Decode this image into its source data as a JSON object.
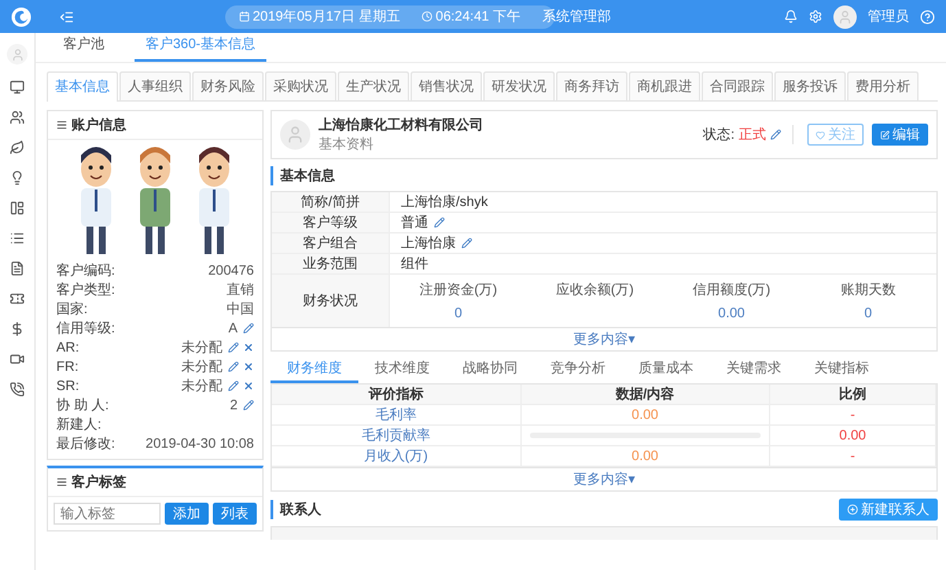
{
  "topbar": {
    "date": "2019年05月17日 星期五",
    "time": "06:24:41 下午",
    "department": "系统管理部",
    "user": "管理员"
  },
  "breadcrumbs": [
    {
      "label": "客户池",
      "selected": false
    },
    {
      "label": "客户360-基本信息",
      "selected": true
    }
  ],
  "tabs": [
    {
      "label": "基本信息",
      "selected": true
    },
    {
      "label": "人事组织",
      "selected": false
    },
    {
      "label": "财务风险",
      "selected": false
    },
    {
      "label": "采购状况",
      "selected": false
    },
    {
      "label": "生产状况",
      "selected": false
    },
    {
      "label": "销售状况",
      "selected": false
    },
    {
      "label": "研发状况",
      "selected": false
    },
    {
      "label": "商务拜访",
      "selected": false
    },
    {
      "label": "商机跟进",
      "selected": false
    },
    {
      "label": "合同跟踪",
      "selected": false
    },
    {
      "label": "服务投诉",
      "selected": false
    },
    {
      "label": "费用分析",
      "selected": false
    }
  ],
  "account_panel": {
    "title": "账户信息",
    "fields": [
      {
        "label": "客户编码:",
        "value": "200476",
        "editable": false,
        "removable": false
      },
      {
        "label": "客户类型:",
        "value": "直销",
        "editable": false,
        "removable": false
      },
      {
        "label": "国家:",
        "value": "中国",
        "editable": false,
        "removable": false
      },
      {
        "label": "信用等级:",
        "value": "A",
        "editable": true,
        "removable": false
      },
      {
        "label": "AR:",
        "value": "未分配",
        "editable": true,
        "removable": true
      },
      {
        "label": "FR:",
        "value": "未分配",
        "editable": true,
        "removable": true
      },
      {
        "label": "SR:",
        "value": "未分配",
        "editable": true,
        "removable": true
      },
      {
        "label": "协 助 人:",
        "value": "2",
        "editable": true,
        "removable": false
      },
      {
        "label": "新建人:",
        "editable": false,
        "removable": false
      },
      {
        "label": "最后修改:",
        "value": "2019-04-30 10:08",
        "editable": false,
        "removable": false
      }
    ]
  },
  "tag_panel": {
    "title": "客户标签",
    "placeholder": "输入标签",
    "buttons": [
      "添加",
      "列表"
    ]
  },
  "company": {
    "name": "上海怡康化工材料有限公司",
    "subtitle": "基本资料",
    "status_label": "状态:",
    "status": "正式",
    "buttons": [
      {
        "label": "关注",
        "kind": "outline"
      },
      {
        "label": "编辑",
        "kind": "primary"
      }
    ]
  },
  "basic_info": {
    "title": "基本信息",
    "rows": [
      {
        "label": "简称/简拼",
        "value": "上海怡康/shyk",
        "editable": false
      },
      {
        "label": "客户等级",
        "value": "普通",
        "editable": true
      },
      {
        "label": "客户组合",
        "value": "上海怡康",
        "editable": true
      },
      {
        "label": "业务范围",
        "value": "组件",
        "editable": false
      }
    ],
    "finance": {
      "label": "财务状况",
      "columns": [
        {
          "label": "注册资金(万)",
          "value": "0"
        },
        {
          "label": "应收余额(万)"
        },
        {
          "label": "信用额度(万)",
          "value": "0.00"
        },
        {
          "label": "账期天数",
          "value": "0"
        }
      ]
    },
    "more": "更多内容▾"
  },
  "sub_tabs": [
    {
      "label": "财务维度",
      "selected": true
    },
    {
      "label": "技术维度",
      "selected": false
    },
    {
      "label": "战略协同",
      "selected": false
    },
    {
      "label": "竞争分析",
      "selected": false
    },
    {
      "label": "质量成本",
      "selected": false
    },
    {
      "label": "关键需求",
      "selected": false
    },
    {
      "label": "关键指标",
      "selected": false
    }
  ],
  "metrics_table": {
    "columns": [
      "评价指标",
      "数据/内容",
      "比例"
    ],
    "rows": [
      {
        "name": "毛利率",
        "kind": "text",
        "value": "0.00",
        "ratio": "-"
      },
      {
        "name": "毛利贡献率",
        "kind": "bar",
        "level": 0,
        "ratio": "0.00"
      },
      {
        "name": "月收入(万)",
        "kind": "text",
        "value": "0.00",
        "ratio": "-"
      }
    ],
    "more": "更多内容▾"
  },
  "contacts": {
    "title": "联系人",
    "button": "新建联系人"
  }
}
